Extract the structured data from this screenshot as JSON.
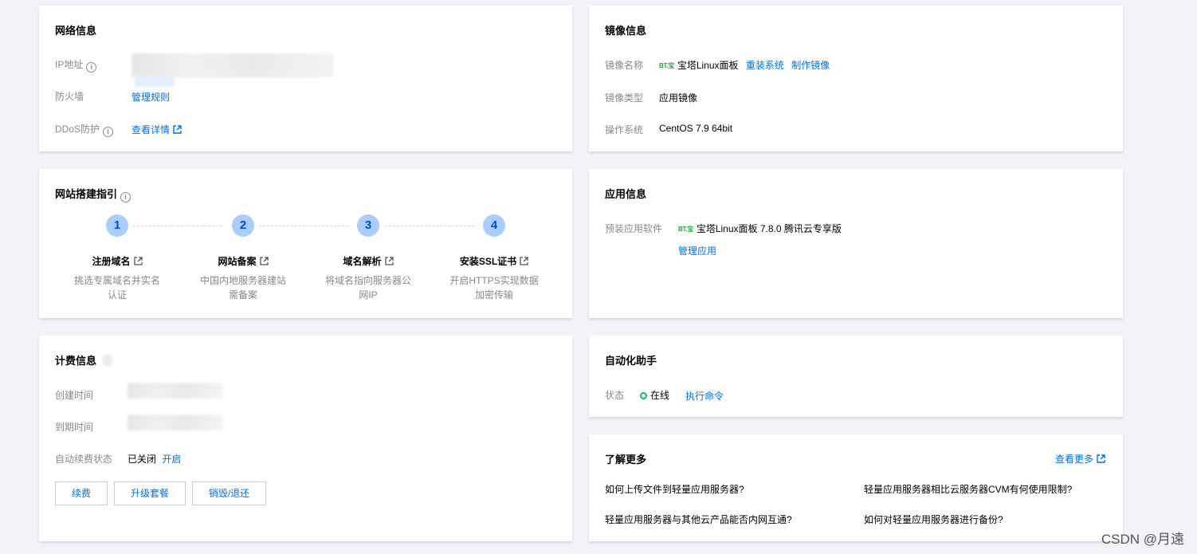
{
  "network": {
    "title": "网络信息",
    "ip_label": "IP地址",
    "firewall_label": "防火墙",
    "firewall_link": "管理规则",
    "ddos_label": "DDoS防护",
    "ddos_link": "查看详情"
  },
  "image": {
    "title": "镜像信息",
    "name_label": "镜像名称",
    "logo_text": "BT.宝",
    "name_value": "宝塔Linux面板",
    "reinstall_link": "重装系统",
    "make_image_link": "制作镜像",
    "type_label": "镜像类型",
    "type_value": "应用镜像",
    "os_label": "操作系统",
    "os_value": "CentOS 7.9 64bit"
  },
  "guide": {
    "title": "网站搭建指引",
    "steps": [
      {
        "num": "1",
        "title": "注册域名",
        "desc": "挑选专属域名并实名认证"
      },
      {
        "num": "2",
        "title": "网站备案",
        "desc": "中国内地服务器建站需备案"
      },
      {
        "num": "3",
        "title": "域名解析",
        "desc": "将域名指向服务器公网IP"
      },
      {
        "num": "4",
        "title": "安装SSL证书",
        "desc": "开启HTTPS实现数据加密传输"
      }
    ]
  },
  "app": {
    "title": "应用信息",
    "software_label": "预装应用软件",
    "logo_text": "BT.宝",
    "software_value": "宝塔Linux面板 7.8.0 腾讯云专享版",
    "manage_link": "管理应用"
  },
  "billing": {
    "title": "计费信息",
    "created_label": "创建时间",
    "expire_label": "到期时间",
    "autorenew_label": "自动续费状态",
    "autorenew_value": "已关闭",
    "autorenew_link": "开启",
    "buttons": {
      "renew": "续费",
      "upgrade": "升级套餐",
      "destroy": "销毁/退还"
    }
  },
  "automation": {
    "title": "自动化助手",
    "status_label": "状态",
    "status_value": "在线",
    "status_color": "#0abf5b",
    "exec_link": "执行命令"
  },
  "learn": {
    "title": "了解更多",
    "more_link": "查看更多",
    "faqs": [
      "如何上传文件到轻量应用服务器?",
      "轻量应用服务器相比云服务器CVM有何使用限制?",
      "轻量应用服务器与其他云产品能否内网互通?",
      "如何对轻量应用服务器进行备份?"
    ]
  },
  "watermark": "CSDN @月遠",
  "colors": {
    "link": "#006eff",
    "step_circle": "#a9cdfd",
    "background": "#f2f3f8"
  }
}
